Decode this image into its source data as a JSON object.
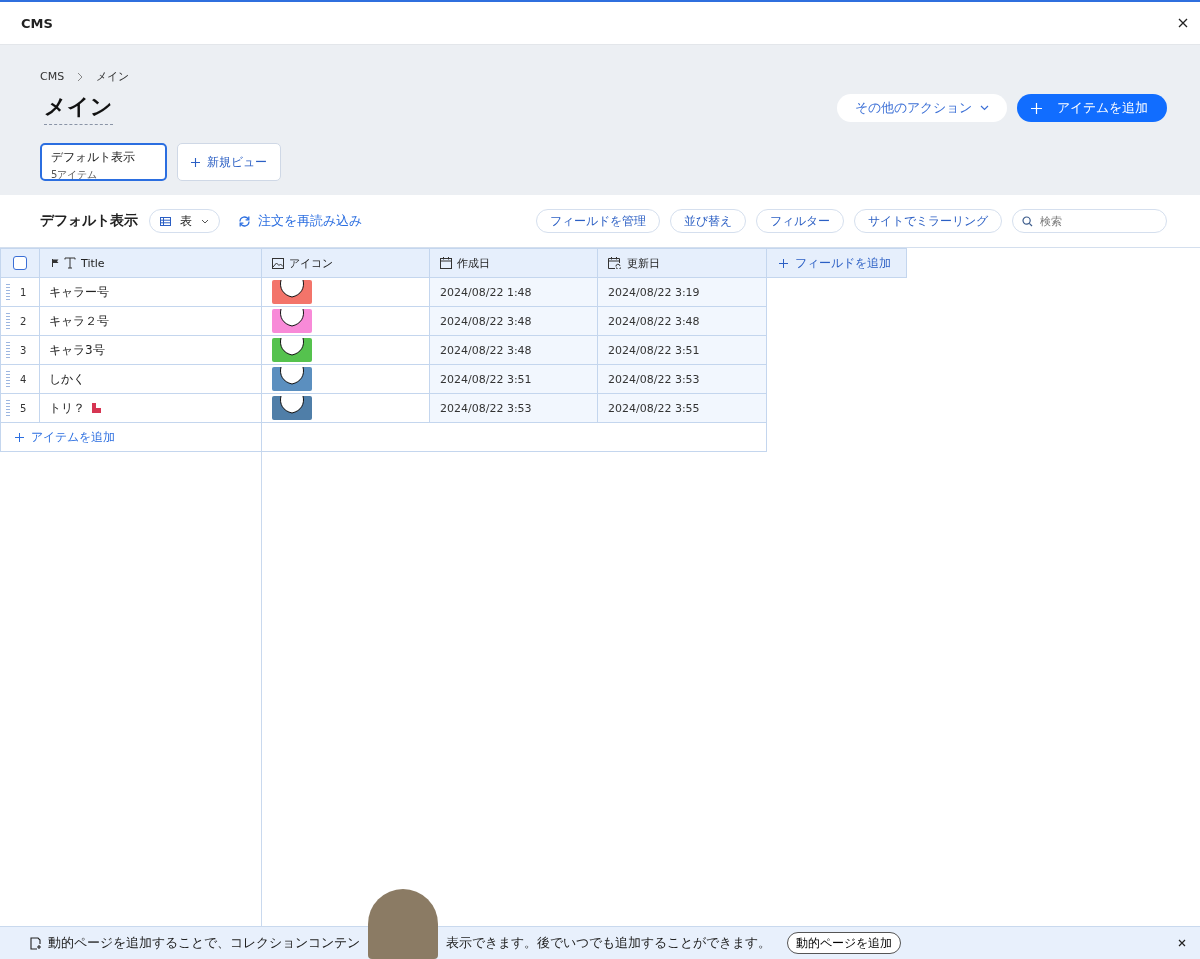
{
  "window": {
    "title": "CMS"
  },
  "breadcrumb": [
    "CMS",
    "メイン"
  ],
  "page_title": "メイン",
  "header_actions": [
    {
      "label": "その他のアクション",
      "kind": "menu"
    },
    {
      "label": "アイテムを追加",
      "kind": "primary"
    }
  ],
  "views": [
    {
      "label": "デフォルト表示",
      "count": "5アイテム",
      "selected": true
    }
  ],
  "new_view": "新規ビュー",
  "toolbar": {
    "title": "デフォルト表示",
    "layout": "表",
    "reload": "注文を再読み込み",
    "buttons": [
      "フィールドを管理",
      "並び替え",
      "フィルター",
      "サイトでミラーリング"
    ],
    "search": {
      "placeholder": "検索"
    }
  },
  "table": {
    "columns": [
      {
        "label": "Title",
        "kind": "title"
      },
      {
        "label": "アイコン",
        "kind": "image"
      },
      {
        "label": "作成日",
        "kind": "date"
      },
      {
        "label": "更新日",
        "kind": "updated"
      }
    ],
    "add_field": "フィールドを追加",
    "select_all": {
      "checked": false
    },
    "rows": [
      {
        "number": "1",
        "title": "キャラー号",
        "badge": false,
        "color": "#f3746a",
        "created": "2024/08/22 1:48",
        "updated": "2024/08/22 3:19"
      },
      {
        "number": "2",
        "title": "キャラ２号",
        "badge": false,
        "color": "#f88ad8",
        "created": "2024/08/22 3:48",
        "updated": "2024/08/22 3:48"
      },
      {
        "number": "3",
        "title": "キャラ3号",
        "badge": false,
        "color": "#55c24e",
        "created": "2024/08/22 3:48",
        "updated": "2024/08/22 3:51"
      },
      {
        "number": "4",
        "title": "しかく",
        "badge": false,
        "color": "#5b8fbf",
        "created": "2024/08/22 3:51",
        "updated": "2024/08/22 3:53"
      },
      {
        "number": "5",
        "title": "トリ？",
        "badge": true,
        "color": "#4f7ea8",
        "created": "2024/08/22 3:53",
        "updated": "2024/08/22 3:55"
      }
    ],
    "add_item": "アイテムを追加"
  },
  "banner": {
    "text_parts": [
      "動的ページを追加することで、コレクションコンテン",
      "表示できます。後でいつでも追加することができます。"
    ],
    "button": "動的ページを追加"
  }
}
